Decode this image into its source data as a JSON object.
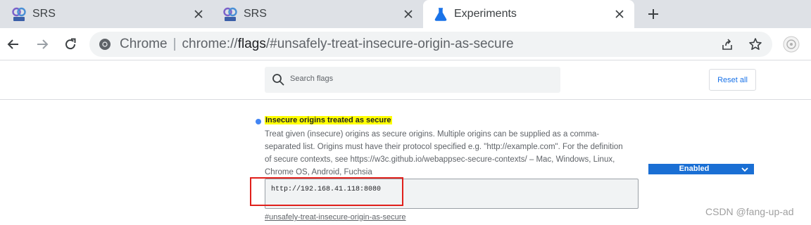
{
  "tabs": [
    {
      "title": "SRS",
      "favicon": "srs-icon",
      "active": false
    },
    {
      "title": "SRS",
      "favicon": "srs-icon",
      "active": false
    },
    {
      "title": "Experiments",
      "favicon": "flask-icon",
      "active": true
    }
  ],
  "omnibox": {
    "origin_label": "Chrome",
    "url_scheme": "chrome://",
    "url_host": "flags",
    "url_path": "/#unsafely-treat-insecure-origin-as-secure"
  },
  "flags_page": {
    "search_placeholder": "Search flags",
    "reset_label": "Reset all",
    "flag": {
      "title": "Insecure origins treated as secure",
      "description": "Treat given (insecure) origins as secure origins. Multiple origins can be supplied as a comma-separated list. Origins must have their protocol specified e.g. \"http://example.com\". For the definition of secure contexts, see https://w3c.github.io/webappsec-secure-contexts/ – Mac, Windows, Linux, Chrome OS, Android, Fuchsia",
      "textarea_value": "http://192.168.41.118:8080",
      "select_value": "Enabled",
      "anchor": "#unsafely-treat-insecure-origin-as-secure"
    }
  },
  "watermark": "CSDN @fang-up-ad",
  "colors": {
    "tabstrip": "#dee1e6",
    "accent": "#1a73e8",
    "select_bg": "#1a6fd4",
    "highlight_marker": "#ffff00",
    "annotation_box": "#e0201b"
  }
}
